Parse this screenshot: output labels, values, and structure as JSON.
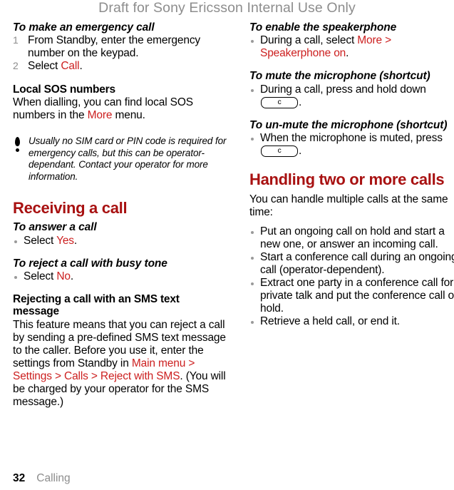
{
  "header": {
    "watermark": "Draft for Sony Ericsson Internal Use Only"
  },
  "colors": {
    "heading_red": "#a81111",
    "link_red": "#cc1f1f",
    "muted_gray": "#8d8d8d",
    "bullet_gray": "#9a9a9a"
  },
  "left_column": {
    "emergency": {
      "title": "To make an emergency call",
      "steps": [
        {
          "text_before": "From Standby, enter the emergency number on the keypad.",
          "link": "",
          "text_after": ""
        },
        {
          "text_before": "Select ",
          "link": "Call",
          "text_after": "."
        }
      ]
    },
    "local_sos": {
      "heading": "Local SOS numbers",
      "text_before": "When dialling, you can find local SOS numbers in the ",
      "link": "More",
      "text_after": " menu."
    },
    "note": {
      "icon": "exclamation-icon",
      "text": "Usually no SIM card or PIN code is required for emergency calls, but this can be operator-dependant. Contact your operator for more information."
    },
    "receiving_call": {
      "chapter_heading": "Receiving a call",
      "answer": {
        "title": "To answer a call",
        "bullet_before": "Select ",
        "bullet_link": "Yes",
        "bullet_after": "."
      },
      "reject_busy": {
        "title": "To reject a call with busy tone",
        "bullet_before": "Select ",
        "bullet_link": "No",
        "bullet_after": "."
      },
      "reject_sms": {
        "heading": "Rejecting a call with an SMS text message",
        "text_before": "This feature means that you can reject a call by sending a pre-defined SMS text message to the caller. Before you use it, enter the settings from Standby in ",
        "link": "Main menu > Settings > Calls > Reject with SMS",
        "text_after": ". (You will be charged by your operator for the SMS message.)"
      }
    }
  },
  "right_column": {
    "speakerphone": {
      "title": "To enable the speakerphone",
      "bullet_before": "During a call, select ",
      "bullet_link": "More > Speakerphone on",
      "bullet_after": "."
    },
    "mute": {
      "title": "To mute the microphone (shortcut)",
      "bullet_before": "During a call, press and hold down ",
      "key_label": "c",
      "bullet_after": "."
    },
    "unmute": {
      "title": "To un-mute the microphone (shortcut)",
      "bullet_before": "When the microphone is muted, press ",
      "key_label": "c",
      "bullet_after": "."
    },
    "handling_calls": {
      "chapter_heading": "Handling two or more calls",
      "intro": "You can handle multiple calls at the same time:",
      "bullets": [
        "Put an ongoing call on hold and start a new one, or answer an incoming call.",
        "Start a conference call during an ongoing call (operator-dependent).",
        "Extract one party in a conference call for a private talk and put the conference call on hold.",
        "Retrieve a held call, or end it."
      ]
    }
  },
  "footer": {
    "page_number": "32",
    "chapter_name": "Calling"
  }
}
